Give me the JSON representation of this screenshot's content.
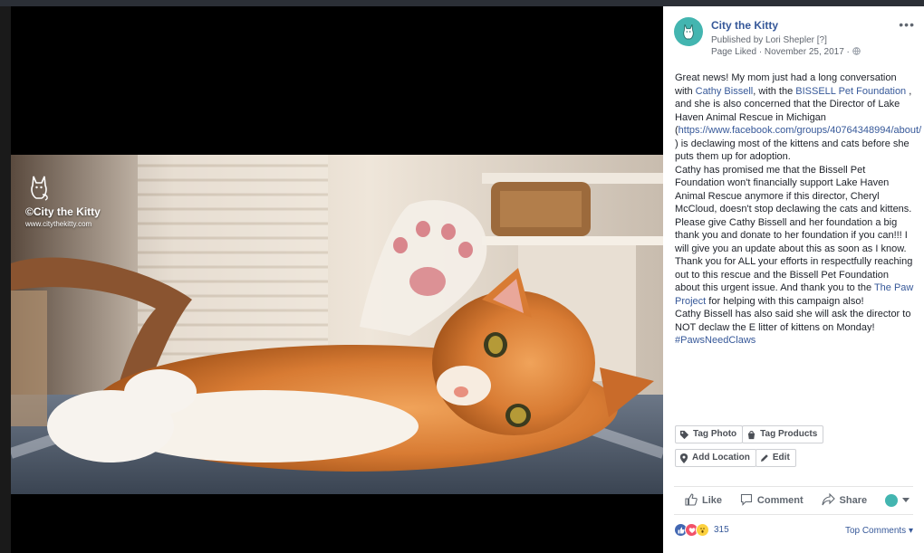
{
  "page": {
    "name": "City the Kitty",
    "published_by": "Published by Lori Shepler [?]",
    "meta": "Page Liked · November 25, 2017 · "
  },
  "post": {
    "p1_a": "Great news! My mom just had a long conversation with ",
    "p1_link1": "Cathy Bissell",
    "p1_b": ", with the ",
    "p1_link2": "BISSELL Pet Foundation",
    "p1_c": " , and she is also concerned that the Director of Lake Haven Animal Rescue in Michigan (",
    "p1_url": "https://www.facebook.com/groups/40764348994/about/",
    "p1_d": " ) is declawing most of the kittens and cats before she puts them up for adoption.",
    "p2": "Cathy has promised me that the Bissell Pet Foundation won't financially support Lake Haven Animal Rescue anymore if this director, Cheryl McCloud, doesn't stop declawing the cats and kittens.",
    "p3_a": "Please give Cathy Bissell and her foundation a big thank you and donate to her foundation if you can!!! I will give you an update about this as soon as I know. Thank you for ALL your efforts in respectfully reaching out to this rescue and the Bissell Pet Foundation about this urgent issue. And thank you to the ",
    "p3_link": "The Paw Project",
    "p3_b": " for helping with this campaign also!",
    "p4": "Cathy Bissell has also said she will ask the director to NOT declaw the E litter of kittens on Monday!",
    "hashtag": "#PawsNeedClaws"
  },
  "watermark": {
    "name": "©City the Kitty",
    "url": "www.citythekitty.com"
  },
  "tag_buttons": {
    "tag_photo": "Tag Photo",
    "tag_products": "Tag Products",
    "add_location": "Add Location",
    "edit": "Edit"
  },
  "actions": {
    "like": "Like",
    "comment": "Comment",
    "share": "Share"
  },
  "reactions": {
    "count": "315",
    "sort": "Top Comments"
  },
  "colors": {
    "link": "#365899",
    "like_blue": "#4267b2",
    "love_red": "#f25268",
    "wow_yellow": "#fcd13f"
  },
  "icons": [
    "kitty-avatar-icon",
    "globe-icon",
    "tag-icon",
    "bag-icon",
    "pin-icon",
    "pencil-icon",
    "thumbs-up-icon",
    "speech-bubble-icon",
    "share-arrow-icon",
    "like-reaction-icon",
    "love-reaction-icon",
    "wow-reaction-icon"
  ]
}
